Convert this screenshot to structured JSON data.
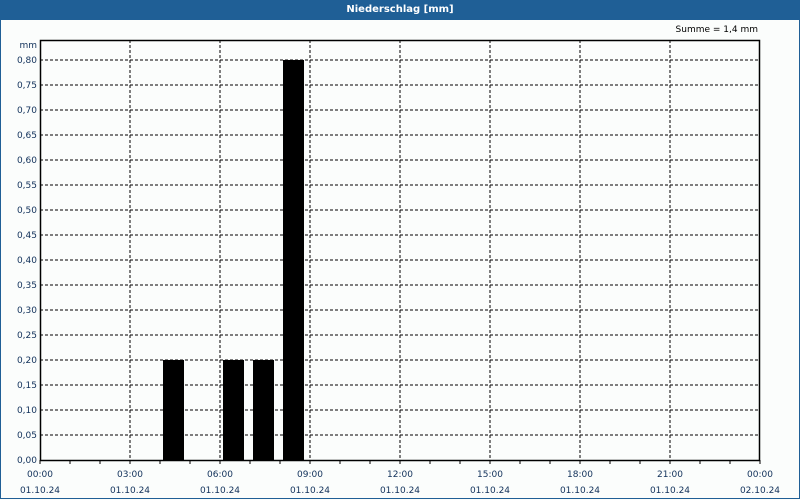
{
  "window": {
    "title": "Niederschlag [mm]"
  },
  "chart_data": {
    "type": "bar",
    "title": "Niederschlag [mm]",
    "ylabel": "mm",
    "annotation": "Summe = 1,4 mm",
    "ylim": [
      0,
      0.84
    ],
    "xlim_hours": [
      0,
      24
    ],
    "yticks": [
      "0,00",
      "0,05",
      "0,10",
      "0,15",
      "0,20",
      "0,25",
      "0,30",
      "0,35",
      "0,40",
      "0,45",
      "0,50",
      "0,55",
      "0,60",
      "0,65",
      "0,70",
      "0,75",
      "0,80"
    ],
    "xticks": [
      {
        "time": "00:00",
        "date": "01.10.24"
      },
      {
        "time": "03:00",
        "date": "01.10.24"
      },
      {
        "time": "06:00",
        "date": "01.10.24"
      },
      {
        "time": "09:00",
        "date": "01.10.24"
      },
      {
        "time": "12:00",
        "date": "01.10.24"
      },
      {
        "time": "15:00",
        "date": "01.10.24"
      },
      {
        "time": "18:00",
        "date": "01.10.24"
      },
      {
        "time": "21:00",
        "date": "01.10.24"
      },
      {
        "time": "00:00",
        "date": "02.10.24"
      }
    ],
    "bars": [
      {
        "hour": 4,
        "value": 0.2
      },
      {
        "hour": 6,
        "value": 0.2
      },
      {
        "hour": 7,
        "value": 0.2
      },
      {
        "hour": 8,
        "value": 0.8
      }
    ],
    "grid": true,
    "bar_color": "#000000"
  }
}
